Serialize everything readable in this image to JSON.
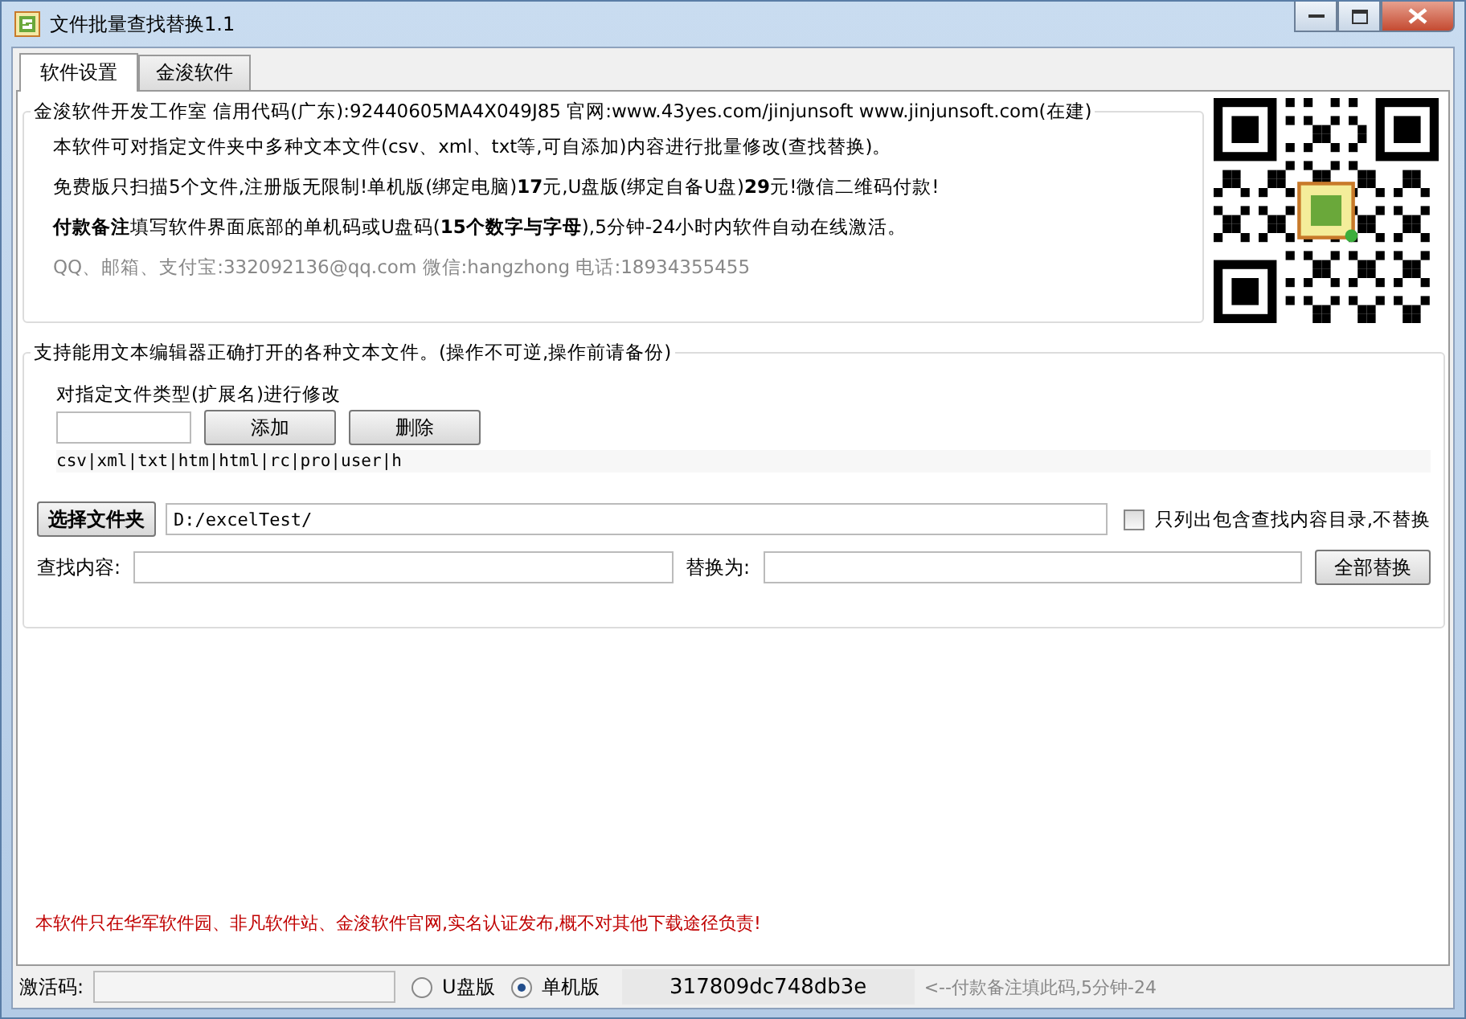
{
  "window": {
    "title": "文件批量查找替换1.1"
  },
  "tabs": [
    {
      "label": "软件设置",
      "selected": true
    },
    {
      "label": "金浚软件",
      "selected": false
    }
  ],
  "info_group": {
    "title": "金浚软件开发工作室 信用代码(广东):92440605MA4X049J85 官网:www.43yes.com/jinjunsoft  www.jinjunsoft.com(在建)",
    "lines": [
      "本软件可对指定文件夹中多种文本文件(csv、xml、txt等,可自添加)内容进行批量修改(查找替换)。",
      "免费版只扫描5个文件,注册版无限制!单机版(绑定电脑)**17**元,U盘版(绑定自备U盘)**29**元!微信二维码付款!",
      "**付款备注**填写软件界面底部的单机码或U盘码(**15个数字与字母**),5分钟-24小时内软件自动在线激活。"
    ],
    "contact": "QQ、邮箱、支付宝:332092136@qq.com    微信:hangzhong    电话:18934355455"
  },
  "work_group": {
    "title": "支持能用文本编辑器正确打开的各种文本文件。(操作不可逆,操作前请备份)",
    "ext_label": "对指定文件类型(扩展名)进行修改",
    "add_button": "添加",
    "delete_button": "删除",
    "ext_list": "csv|xml|txt|htm|html|rc|pro|user|h",
    "folder_button": "选择文件夹",
    "folder_path": "D:/excelTest/",
    "list_only": {
      "label": "只列出包含查找内容目录,不替换",
      "checked": false
    },
    "find_label": "查找内容:",
    "replace_label": "替换为:",
    "replace_all_button": "全部替换"
  },
  "notice": "本软件只在华军软件园、非凡软件站、金浚软件官网,实名认证发布,概不对其他下载途径负责!",
  "status_bar": {
    "activation_label": "激活码:",
    "editions": [
      {
        "label": "U盘版",
        "selected": false
      },
      {
        "label": "单机版",
        "selected": true
      }
    ],
    "machine_code": "317809dc748db3e",
    "hint": "<--付款备注填此码,5分钟-24"
  }
}
